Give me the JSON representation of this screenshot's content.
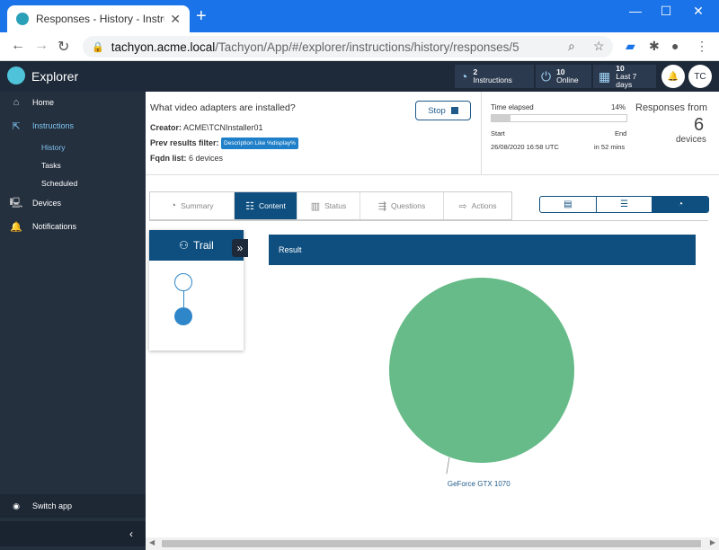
{
  "browser": {
    "tab_title": "Responses - History - Instructions",
    "url_host": "tachyon.acme.local",
    "url_path": "/Tachyon/App/#/explorer/instructions/history/responses/5"
  },
  "topbar": {
    "app_name": "Explorer",
    "instructions_count": "2",
    "instructions_label": "Instructions",
    "online_count": "10",
    "online_label": "Online",
    "last7_count": "10",
    "last7_label": "Last 7 days",
    "avatar_initials": "TC"
  },
  "sidebar": {
    "home": "Home",
    "instructions": "Instructions",
    "history": "History",
    "tasks": "Tasks",
    "scheduled": "Scheduled",
    "devices": "Devices",
    "notifications": "Notifications",
    "switch_app": "Switch app"
  },
  "instruction": {
    "question": "What video adapters are installed?",
    "creator_label": "Creator:",
    "creator_value": "ACME\\TCNInstaller01",
    "filter_label": "Prev results filter:",
    "filter_value": "Description Like %display%",
    "fqdn_label": "Fqdn list:",
    "fqdn_value": "6 devices",
    "stop_label": "Stop",
    "time_elapsed_label": "Time elapsed",
    "time_elapsed_pct": "14%",
    "progress_fraction": 0.14,
    "start_label": "Start",
    "start_value": "26/08/2020 16:58 UTC",
    "end_label": "End",
    "end_value": "in 52 mins",
    "responses_from_label": "Responses from",
    "responses_count": "6",
    "devices_label": "devices"
  },
  "tabs": [
    "Summary",
    "Content",
    "Status",
    "Questions",
    "Actions"
  ],
  "trail": {
    "title": "Trail"
  },
  "result": {
    "header": "Result"
  },
  "colors": {
    "accent": "#0e4f80",
    "pie": "#66bb88",
    "sidebar": "#25303f"
  },
  "chart_data": {
    "type": "pie",
    "categories": [
      "GeForce GTX 1070"
    ],
    "values": [
      6
    ]
  }
}
